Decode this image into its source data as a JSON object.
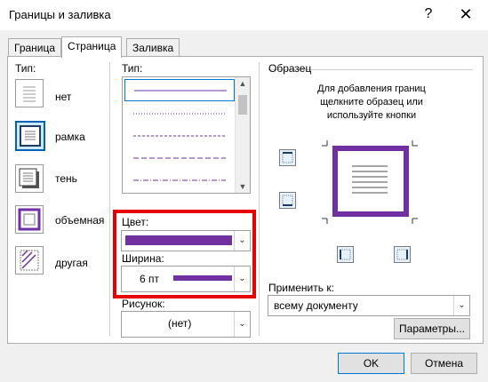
{
  "dialog": {
    "title": "Границы и заливка",
    "help_glyph": "?",
    "close_glyph": "✕"
  },
  "tabs": [
    {
      "label": "Граница",
      "active": false
    },
    {
      "label": "Страница",
      "active": true
    },
    {
      "label": "Заливка",
      "active": false
    }
  ],
  "settings": {
    "label": "Тип:",
    "items": [
      {
        "label": "нет",
        "icon": "border-none-icon"
      },
      {
        "label": "рамка",
        "icon": "border-box-icon",
        "selected": true
      },
      {
        "label": "тень",
        "icon": "border-shadow-icon"
      },
      {
        "label": "объемная",
        "icon": "border-3d-icon"
      },
      {
        "label": "другая",
        "icon": "border-custom-icon"
      }
    ]
  },
  "style": {
    "label": "Тип:",
    "options": [
      "solid",
      "dotted",
      "dashed-short",
      "dashed-long",
      "dash-dot"
    ]
  },
  "color": {
    "label": "Цвет:",
    "value": "#7030a0"
  },
  "width": {
    "label": "Ширина:",
    "value": "6 пт"
  },
  "art": {
    "label": "Рисунок:",
    "value": "(нет)"
  },
  "preview": {
    "label": "Образец",
    "hint": "Для добавления границ щелкните образец или используйте кнопки",
    "border_color": "#7030a0"
  },
  "apply_to": {
    "label": "Применить к:",
    "value": "всему документу"
  },
  "buttons": {
    "options": "Параметры...",
    "ok": "OK",
    "cancel": "Отмена"
  },
  "colors": {
    "accent_purple": "#7030a0",
    "highlight_red": "#e60000",
    "focus_blue": "#0078d7"
  }
}
